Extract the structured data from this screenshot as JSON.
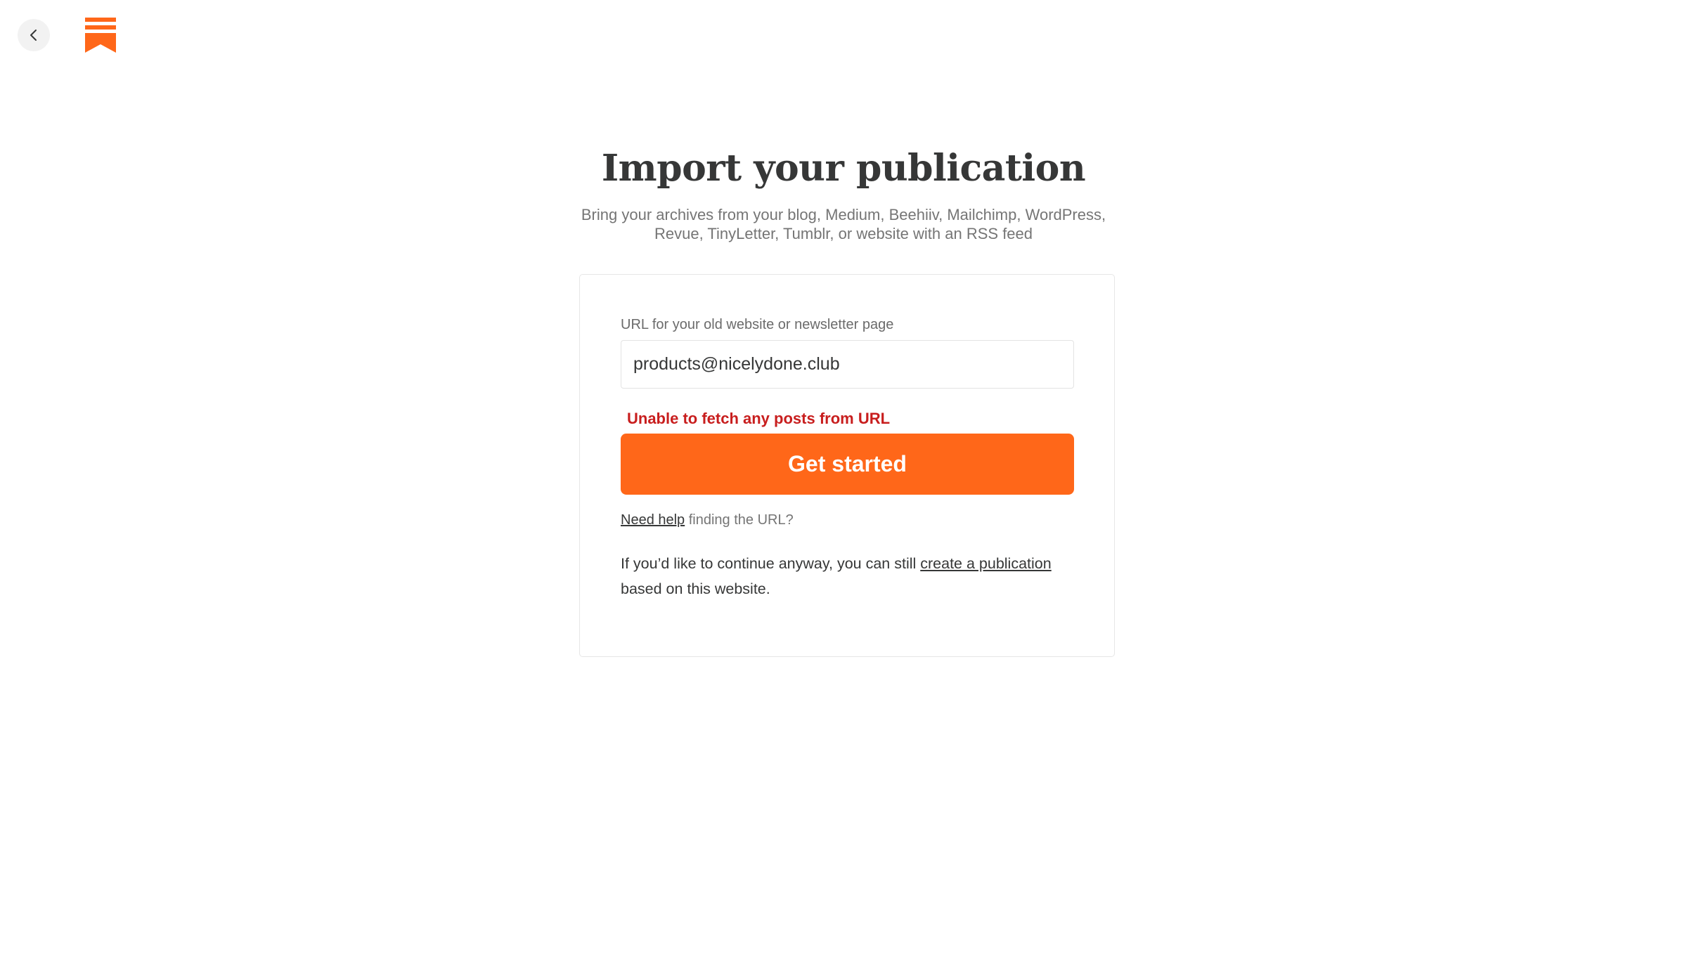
{
  "header": {
    "title": "Import your publication",
    "subtitle_line1": "Bring your archives from your blog, Medium, Beehiiv, Mailchimp, WordPress,",
    "subtitle_line2": "Revue, TinyLetter, Tumblr, or website with an RSS feed"
  },
  "nav": {
    "back_icon": "chevron-left-icon",
    "logo_icon": "substack-logo-icon",
    "brand_color": "#ff6719"
  },
  "form": {
    "url_label": "URL for your old website or newsletter page",
    "url_value": "products@nicelydone.club",
    "error": "Unable to fetch any posts from URL",
    "error_color": "#c81e1e",
    "submit_label": "Get started",
    "help_link": "Need help",
    "help_rest": " finding the URL?",
    "continue_prefix": "If you’d like to continue anyway, you can still ",
    "continue_link": "create a publication",
    "continue_suffix": "based on this website."
  }
}
